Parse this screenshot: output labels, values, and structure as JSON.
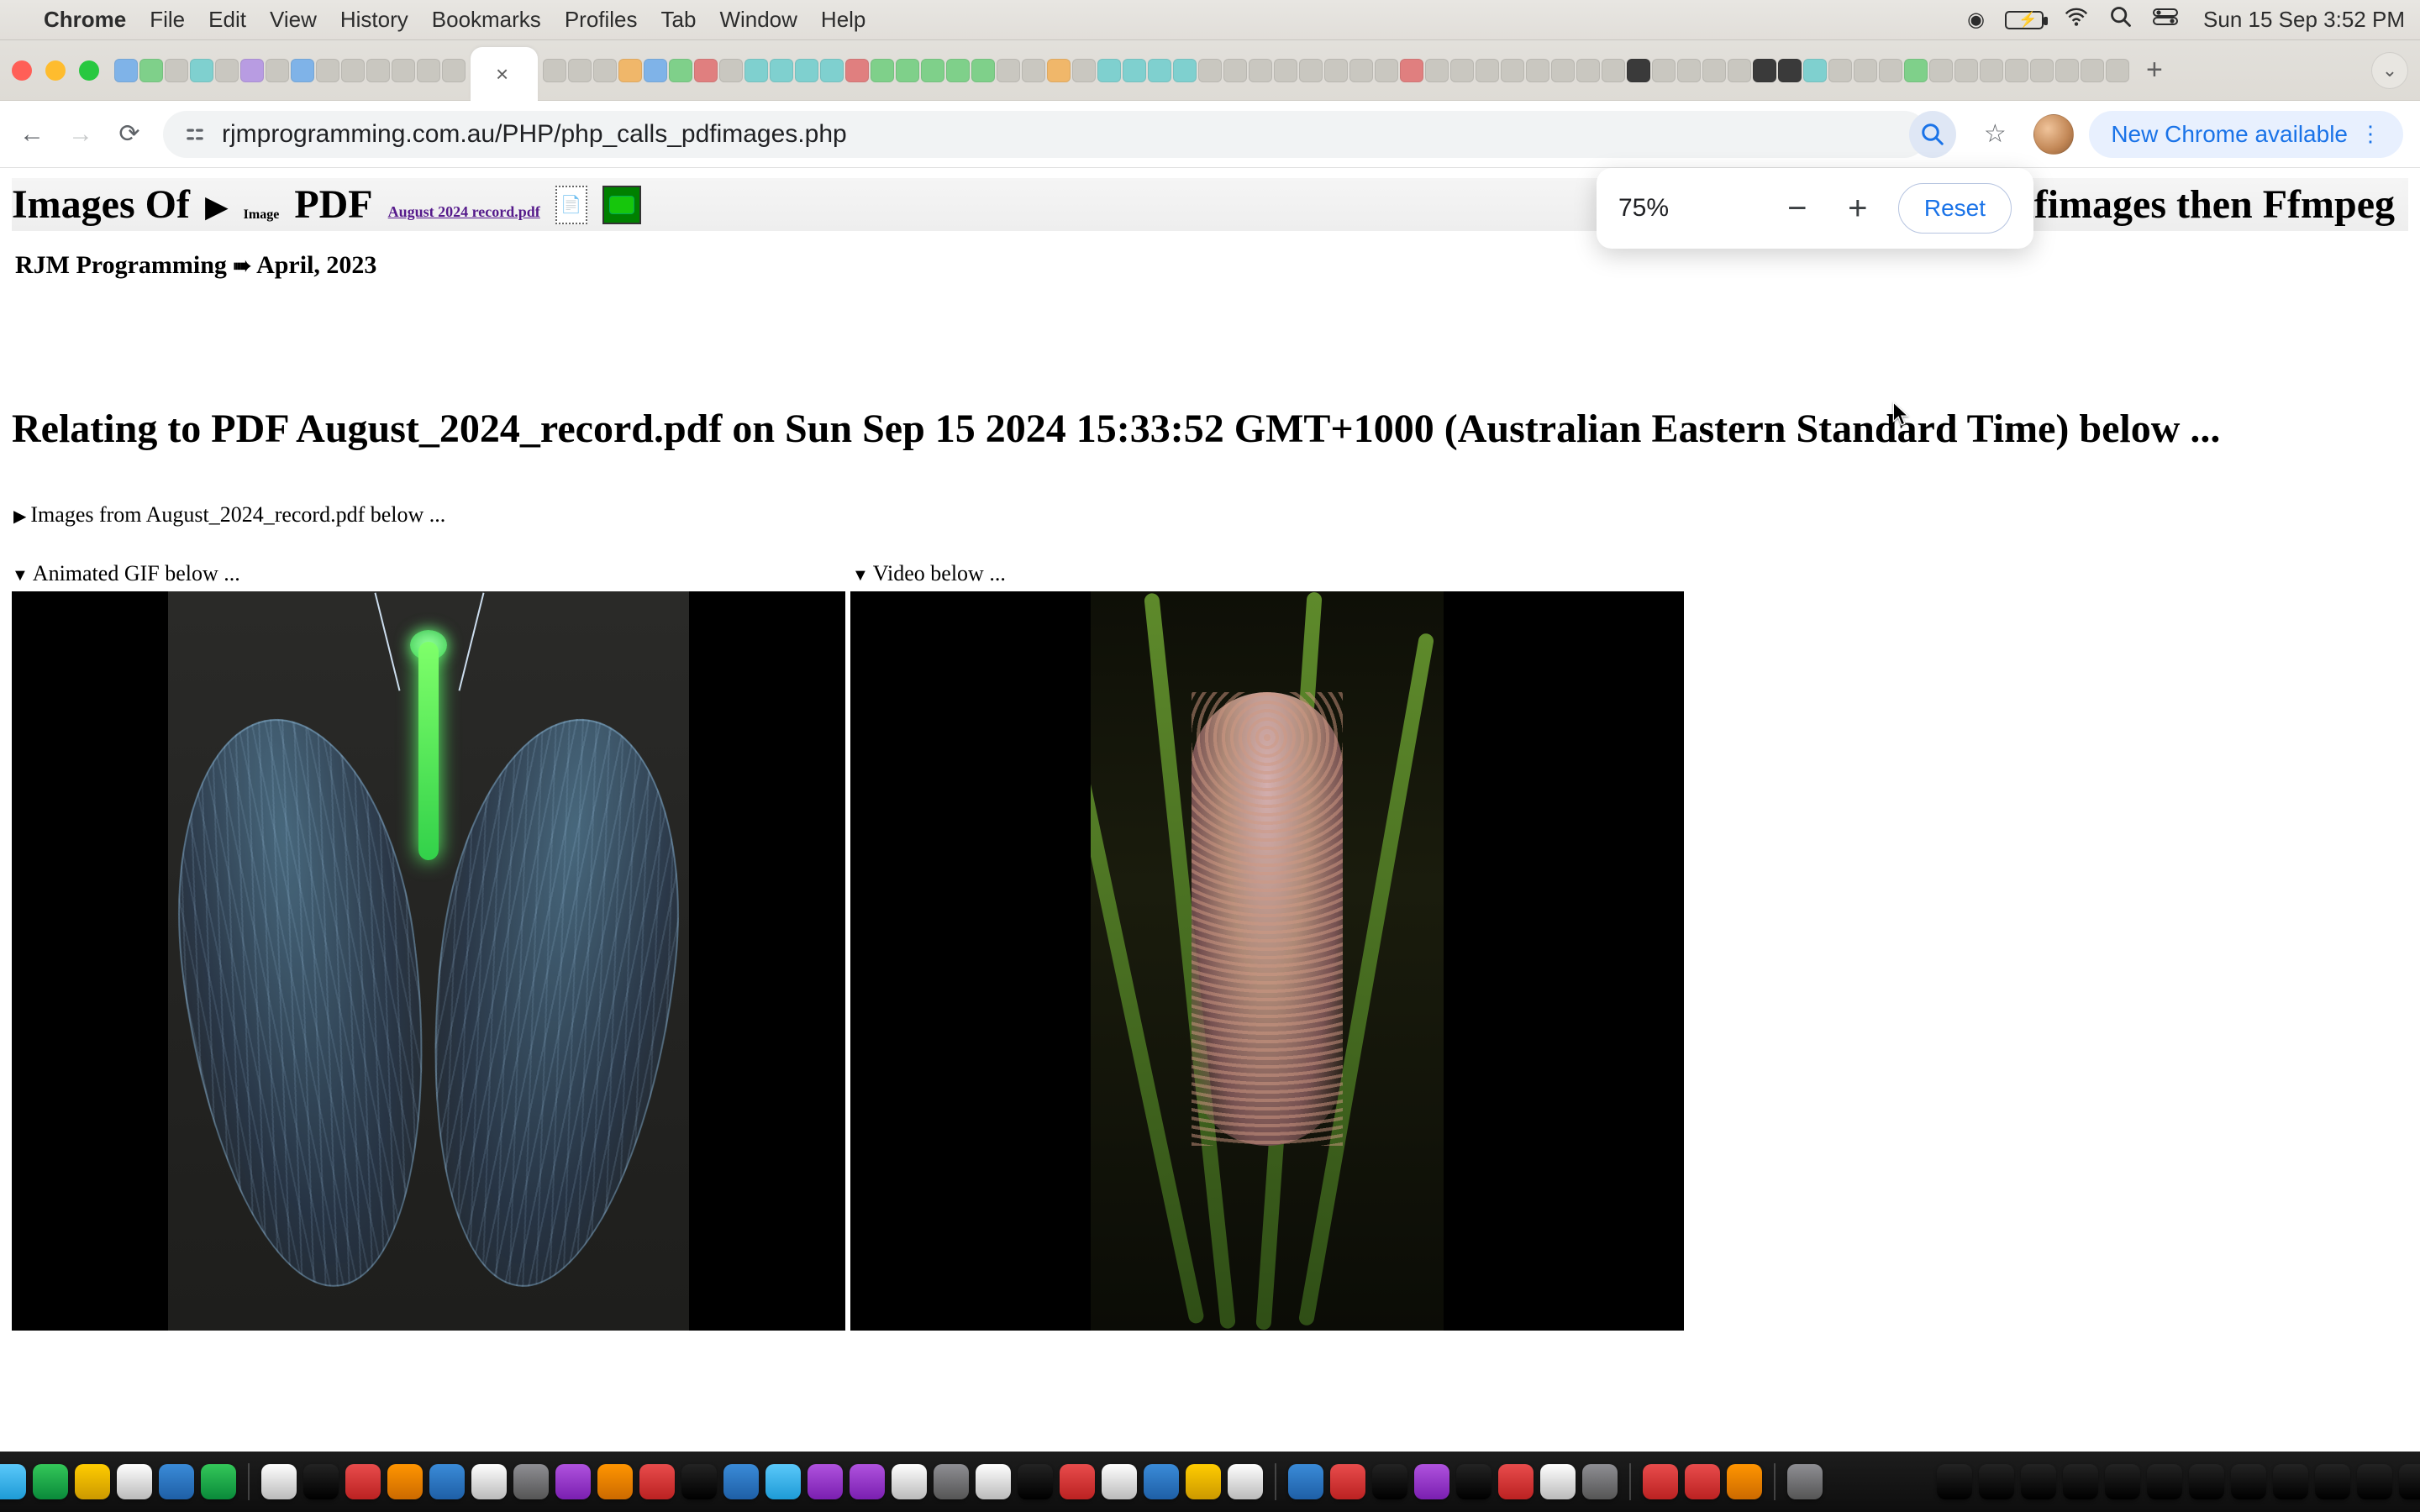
{
  "menubar": {
    "app": "Chrome",
    "items": [
      "File",
      "Edit",
      "View",
      "History",
      "Bookmarks",
      "Profiles",
      "Tab",
      "Window",
      "Help"
    ],
    "clock": "Sun 15 Sep  3:52 PM"
  },
  "browser": {
    "url": "rjmprogramming.com.au/PHP/php_calls_pdfimages.php",
    "active_tab_close": "×",
    "new_tab": "+",
    "update_label": "New Chrome available"
  },
  "zoom": {
    "percent": "75%",
    "minus": "−",
    "plus": "+",
    "reset": "Reset"
  },
  "page": {
    "h1_left": "Images Of",
    "sub_image": "Image",
    "pdf_label": "PDF",
    "crumb": "August 2024 record.pdf",
    "h1_right": "File via Pdfimages then Ffmpeg",
    "byline_site": "RJM Programming",
    "byline_arrow": "➠",
    "byline_date": "April, 2023",
    "h2": "Relating to PDF August_2024_record.pdf on Sun Sep 15 2024 15:33:52 GMT+1000 (Australian Eastern Standard Time) below ...",
    "disclosure": "Images from August_2024_record.pdf below ...",
    "panel_gif": "Animated GIF below ...",
    "panel_video": "Video below ..."
  }
}
